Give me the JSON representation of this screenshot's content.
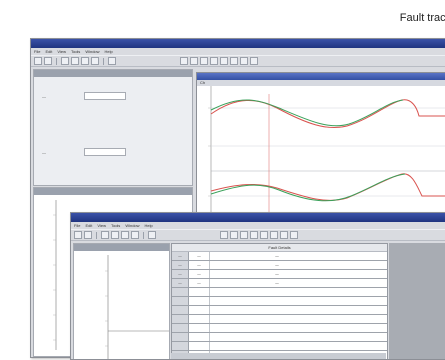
{
  "caption": {
    "text": "Fault traceback"
  },
  "back_window": {
    "menu": [
      "File",
      "Edit",
      "View",
      "Tools",
      "Window",
      "Help"
    ],
    "panel_upper": {
      "field1": "—",
      "field2": "—"
    },
    "wave_tab": "Ch"
  },
  "front_window": {
    "menu": [
      "File",
      "Edit",
      "View",
      "Tools",
      "Window",
      "Help"
    ],
    "table_header": "Fault Details",
    "rows": [
      {
        "id": "—",
        "code": "—",
        "desc": "—"
      },
      {
        "id": "—",
        "code": "—",
        "desc": "—"
      },
      {
        "id": "—",
        "code": "—",
        "desc": "—"
      },
      {
        "id": "—",
        "code": "—",
        "desc": "—"
      },
      {
        "id": "",
        "code": "",
        "desc": ""
      },
      {
        "id": "",
        "code": "",
        "desc": ""
      },
      {
        "id": "",
        "code": "",
        "desc": ""
      },
      {
        "id": "",
        "code": "",
        "desc": ""
      },
      {
        "id": "",
        "code": "",
        "desc": ""
      },
      {
        "id": "",
        "code": "",
        "desc": ""
      },
      {
        "id": "",
        "code": "",
        "desc": ""
      },
      {
        "id": "",
        "code": "",
        "desc": ""
      }
    ]
  },
  "colors": {
    "titlebar": "#1f3480",
    "wave_red": "#d9534f",
    "wave_green": "#3aa15a",
    "cursor": "#e07a7a"
  }
}
